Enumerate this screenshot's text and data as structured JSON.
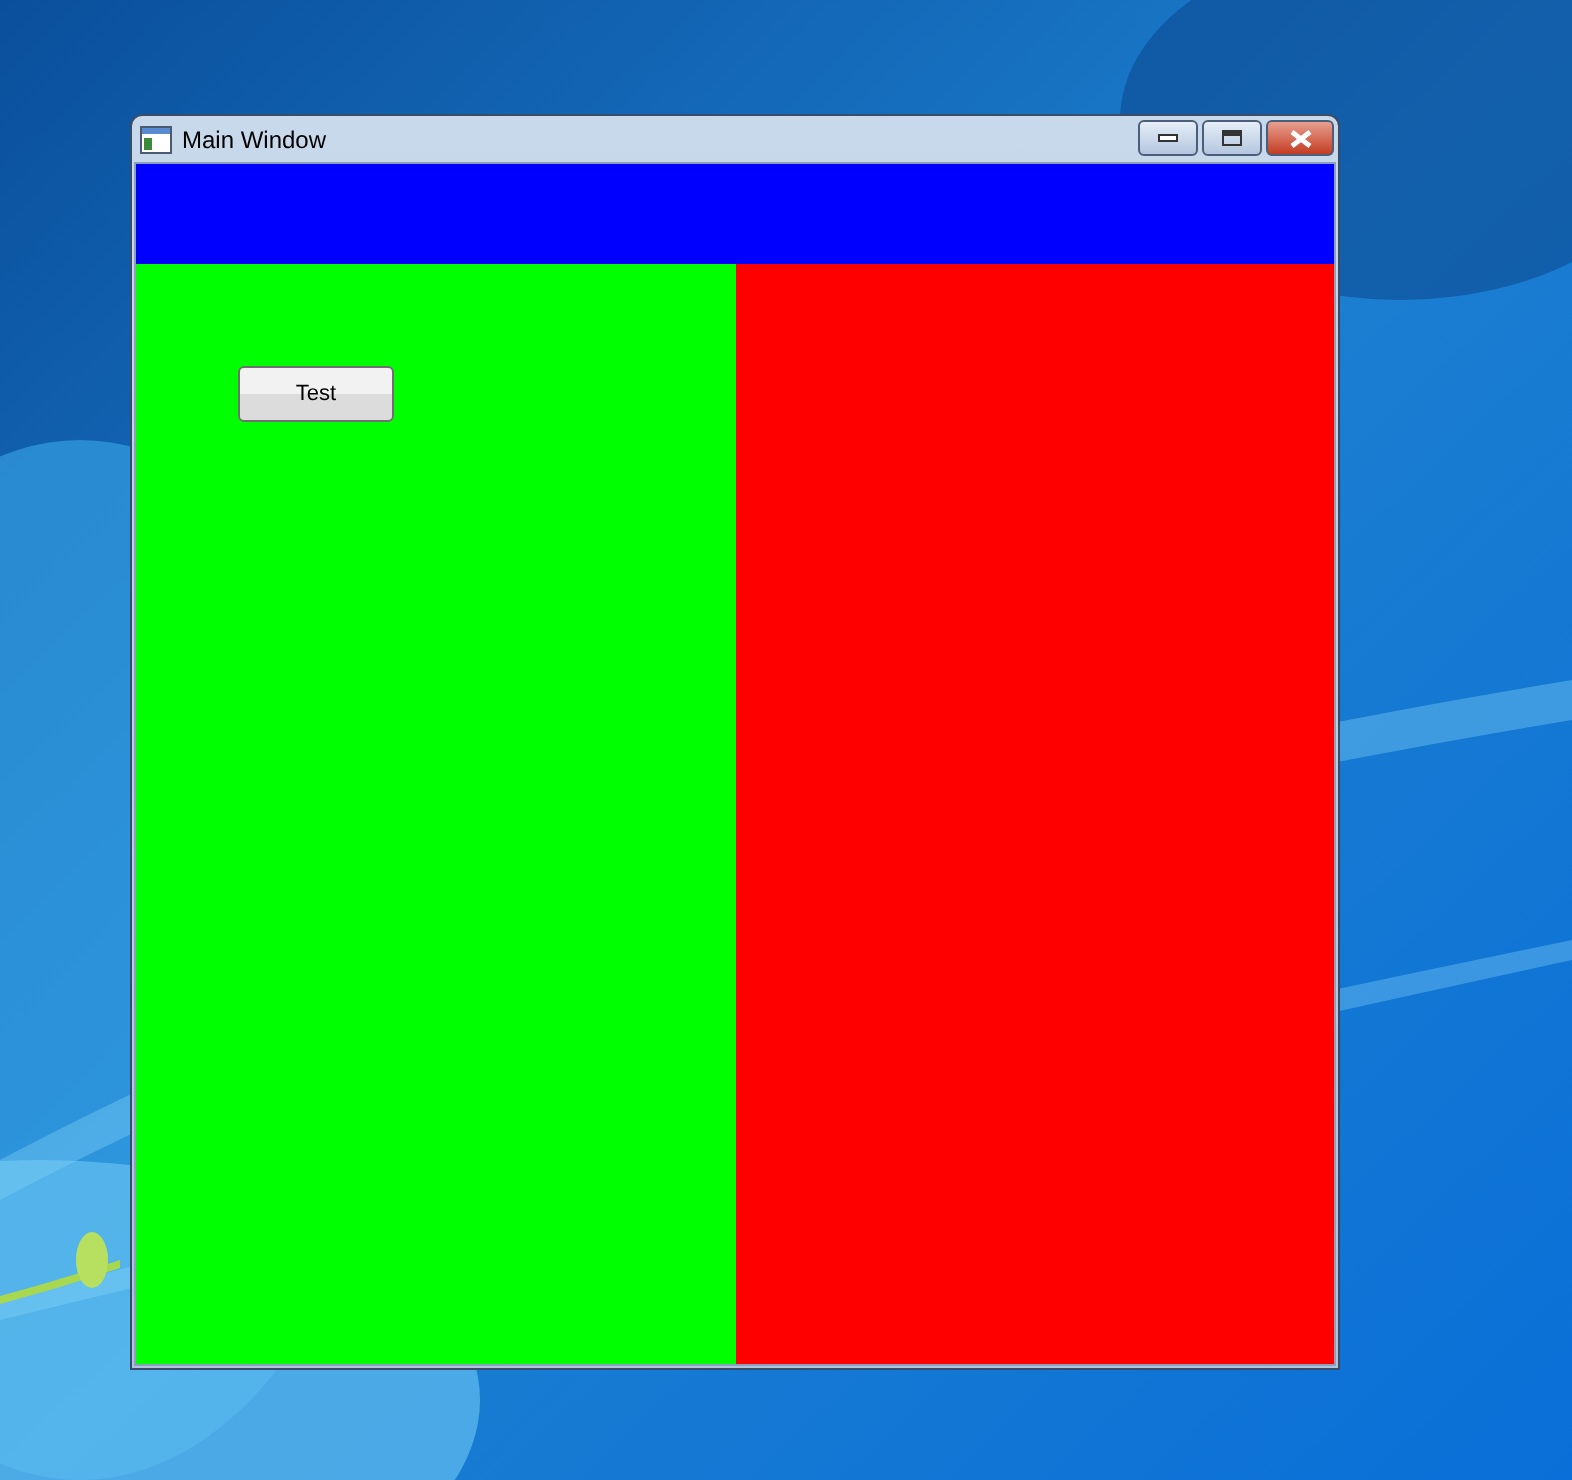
{
  "window": {
    "title": "Main Window"
  },
  "panels": [
    {
      "kind": "top",
      "color": "#0000ff"
    },
    {
      "kind": "left",
      "color": "#00ff00"
    },
    {
      "kind": "right",
      "color": "#ff0000"
    }
  ],
  "button": {
    "label": "Test"
  }
}
